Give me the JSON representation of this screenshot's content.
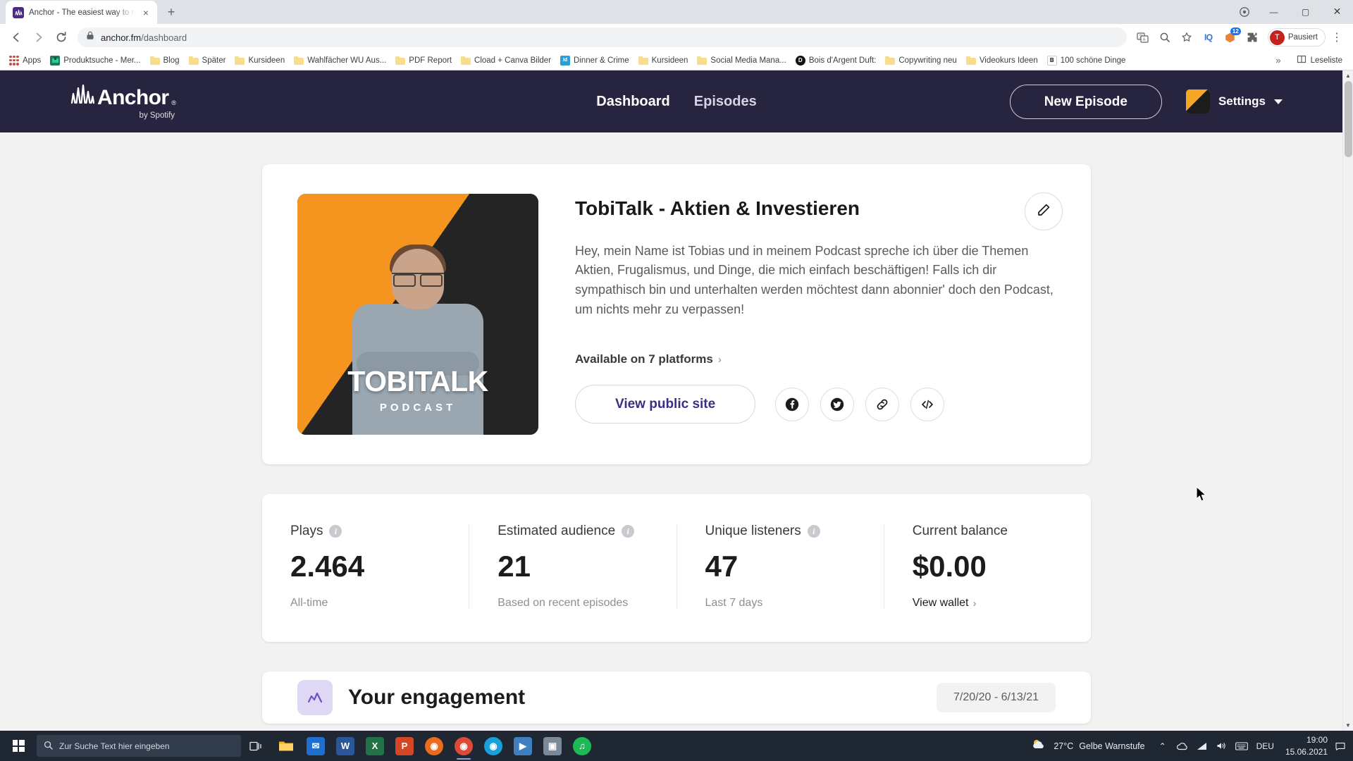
{
  "browser": {
    "tab": {
      "title": "Anchor - The easiest way to mak",
      "favicon": "anchor-icon",
      "close": "×"
    },
    "new_tab_label": "+",
    "window_controls": {
      "minimize": "—",
      "maximize": "▢",
      "close": "✕"
    },
    "nav": {
      "back": "←",
      "forward": "→",
      "reload": "⟳"
    },
    "omnibox": {
      "lock": "lock-icon",
      "host": "anchor.fm",
      "path": "/dashboard",
      "translate": "translate-icon",
      "zoom": "search-zoom-icon",
      "bookmark_star": "★"
    },
    "toolbar_right": {
      "iq_label": "IQ",
      "ext_badge": "12",
      "profile_initial": "T",
      "profile_label": "Pausiert",
      "menu": "⋮"
    },
    "bookmarks": {
      "apps_label": "Apps",
      "items": [
        {
          "label": "Produktsuche - Mer...",
          "icon": "site-icon",
          "color": "#1d7a5f"
        },
        {
          "label": "Blog",
          "icon": "folder-icon"
        },
        {
          "label": "Später",
          "icon": "folder-icon"
        },
        {
          "label": "Kursideen",
          "icon": "folder-icon"
        },
        {
          "label": "Wahlfächer WU Aus...",
          "icon": "folder-icon"
        },
        {
          "label": "PDF Report",
          "icon": "folder-icon"
        },
        {
          "label": "Cload + Canva Bilder",
          "icon": "folder-icon"
        },
        {
          "label": "Dinner & Crime",
          "icon": "site-icon",
          "color": "#2b9ed8",
          "initial": "Id"
        },
        {
          "label": "Kursideen",
          "icon": "folder-icon"
        },
        {
          "label": "Social Media Mana...",
          "icon": "folder-icon"
        },
        {
          "label": "Bois d'Argent Duft:",
          "icon": "site-icon",
          "color": "#111111",
          "initial": "D"
        },
        {
          "label": "Copywriting neu",
          "icon": "folder-icon"
        },
        {
          "label": "Videokurs Ideen",
          "icon": "folder-icon"
        },
        {
          "label": "100 schöne Dinge",
          "icon": "site-icon",
          "color": "#ffffff",
          "initial": "B"
        }
      ],
      "overflow": "»",
      "reading_list": "Leseliste"
    }
  },
  "anchor": {
    "logo": {
      "name": "Anchor",
      "registered": "®",
      "byline": "by Spotify"
    },
    "nav_links": [
      {
        "label": "Dashboard",
        "active": true
      },
      {
        "label": "Episodes",
        "active": false
      }
    ],
    "new_episode_label": "New Episode",
    "settings_label": "Settings"
  },
  "profile": {
    "cover": {
      "title": "TOBITALK",
      "subtitle": "PODCAST"
    },
    "title": "TobiTalk - Aktien & Investieren",
    "description": "Hey, mein Name ist Tobias und in meinem Podcast spreche ich über die Themen Aktien, Frugalismus, und Dinge, die mich einfach beschäftigen! Falls ich dir sympathisch bin und unterhalten werden möchtest dann abonnier' doch den Podcast, um nichts mehr zu verpassen!",
    "platforms_label": "Available on 7 platforms",
    "platforms_chevron": "›",
    "public_site_label": "View public site",
    "share_icons": [
      "facebook-icon",
      "twitter-icon",
      "link-icon",
      "embed-code-icon"
    ],
    "edit_icon": "pencil-icon"
  },
  "stats": [
    {
      "label": "Plays",
      "value": "2.464",
      "note": "All-time",
      "info": "info-icon",
      "note_is_link": false
    },
    {
      "label": "Estimated audience",
      "value": "21",
      "note": "Based on recent episodes",
      "info": "info-icon",
      "note_is_link": false
    },
    {
      "label": "Unique listeners",
      "value": "47",
      "note": "Last 7 days",
      "info": "info-icon",
      "note_is_link": false
    },
    {
      "label": "Current balance",
      "value": "$0.00",
      "note": "View wallet",
      "info": "",
      "note_is_link": true,
      "note_chevron": "›"
    }
  ],
  "bottom_card": {
    "title": "Your engagement",
    "date_range": "7/20/20 - 6/13/21"
  },
  "taskbar": {
    "start": "windows-logo",
    "search_placeholder": "Zur Suche Text hier eingeben",
    "apps": [
      {
        "name": "task-view-icon",
        "glyph": "❏",
        "color": "transparent"
      },
      {
        "name": "file-explorer-icon",
        "glyph": "🗀",
        "color": "#f3b31b"
      },
      {
        "name": "mail-icon",
        "glyph": "✉",
        "color": "#1f6fd0"
      },
      {
        "name": "word-icon",
        "glyph": "W",
        "color": "#2b579a"
      },
      {
        "name": "excel-icon",
        "glyph": "X",
        "color": "#217346"
      },
      {
        "name": "powerpoint-icon",
        "glyph": "P",
        "color": "#d24726"
      },
      {
        "name": "firefox-icon",
        "glyph": "◉",
        "color": "#e96b1c"
      },
      {
        "name": "chrome-icon",
        "glyph": "◉",
        "color": "#dd4b38"
      },
      {
        "name": "edge-icon",
        "glyph": "◉",
        "color": "#19a0da"
      },
      {
        "name": "video-editor-icon",
        "glyph": "▶",
        "color": "#3f7fbf"
      },
      {
        "name": "photos-icon",
        "glyph": "▣",
        "color": "#7a8a99"
      },
      {
        "name": "spotify-icon",
        "glyph": "♫",
        "color": "#1db954"
      }
    ],
    "weather": {
      "icon": "partly-cloudy-icon",
      "temp": "27°C",
      "warning": "Gelbe Warnstufe"
    },
    "tray": {
      "chevron": "⌃",
      "onedrive": "☁",
      "network": "⎚",
      "volume": "🔊",
      "keyboard": "⌨",
      "language": "DEU"
    },
    "clock": {
      "time": "19:00",
      "date": "15.06.2021"
    },
    "notification": "▭"
  }
}
